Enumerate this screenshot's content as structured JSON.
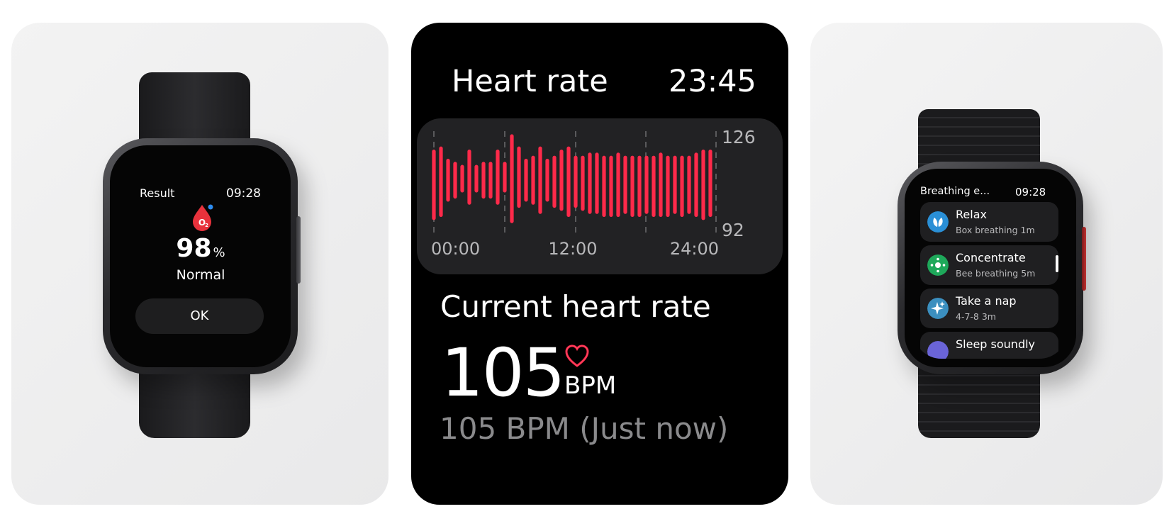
{
  "spo2_watch": {
    "title": "Result",
    "time": "09:28",
    "icon": "oxygen-drop-icon",
    "value": "98",
    "unit": "%",
    "status": "Normal",
    "ok_label": "OK",
    "accent": "#e8323c"
  },
  "heart_rate_screen": {
    "title": "Heart rate",
    "time": "23:45",
    "current_label": "Current heart rate",
    "value": "105",
    "unit": "BPM",
    "last_reading": "105 BPM (Just now)",
    "accent": "#ff2a4a",
    "chart_data": {
      "type": "bar",
      "x_tick_labels": [
        "00:00",
        "12:00",
        "24:00"
      ],
      "y_tick_labels": [
        "126",
        "92"
      ],
      "ylim": [
        92,
        126
      ],
      "series": [
        {
          "values_min": [
            97,
            98,
            103,
            104,
            106,
            102,
            106,
            104,
            104,
            102,
            106,
            96,
            101,
            103,
            102,
            99,
            103,
            101,
            100,
            98,
            101,
            100,
            99,
            99,
            98,
            98,
            98,
            99,
            98,
            98,
            99,
            98,
            98,
            98,
            99,
            98,
            99,
            98,
            97,
            98
          ],
          "values_max": [
            120,
            121,
            117,
            116,
            115,
            120,
            115,
            116,
            116,
            120,
            116,
            125,
            121,
            117,
            118,
            121,
            117,
            118,
            120,
            121,
            118,
            118,
            119,
            119,
            118,
            118,
            119,
            118,
            118,
            118,
            118,
            118,
            119,
            118,
            118,
            118,
            118,
            119,
            120,
            120
          ]
        }
      ],
      "grid": true
    }
  },
  "breathing_watch": {
    "title": "Breathing e...",
    "time": "09:28",
    "items": [
      {
        "name": "Relax",
        "sub": "Box breathing 1m",
        "icon": "leaf-icon",
        "color": "#2a8fd6"
      },
      {
        "name": "Concentrate",
        "sub": "Bee breathing 5m",
        "icon": "focus-icon",
        "color": "#1ea85a"
      },
      {
        "name": "Take a nap",
        "sub": "4-7-8 3m",
        "icon": "sparkle-icon",
        "color": "#3b8fbf"
      },
      {
        "name": "Sleep soundly",
        "sub": "",
        "icon": "moon-icon",
        "color": "#6a64d8"
      }
    ]
  }
}
